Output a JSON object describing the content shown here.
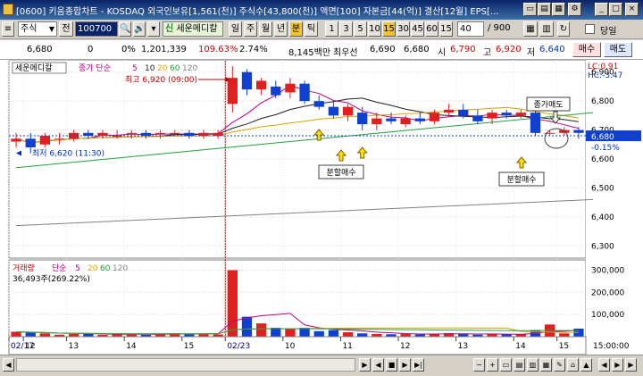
{
  "window": {
    "title": "[0600] 키움종합차트 - KOSDAQ 외국인보유[1,561(천)] 주식수[43,800(천)] 액면[100] 자본금[44(억)] 결산[12월] EPS[..."
  },
  "toolbar": {
    "market_label": "주식",
    "prev_label": "전",
    "code_value": "100700",
    "stock_name": "세운메디칼",
    "period_buttons": [
      "일",
      "주",
      "월",
      "년",
      "분",
      "틱"
    ],
    "minute_buttons": [
      "1",
      "3",
      "5",
      "10",
      "15",
      "30",
      "45",
      "60",
      "15"
    ],
    "active_period": "분",
    "count_value": "40",
    "count_total": "/ 900",
    "overlap_label": "당일"
  },
  "info": {
    "price": "6,680",
    "change": "0",
    "change_pct": "0%",
    "volume": "1,201,339",
    "vol_ratio": "109.63%",
    "turnover": "2.74%",
    "amount": "8,145백만",
    "best_ask_label": "최우선",
    "best_ask": "6,690",
    "best_bid": "6,680",
    "open_label": "시",
    "open": "6,790",
    "high_label": "고",
    "high": "6,920",
    "low_label": "저",
    "low": "6,640",
    "buy_label": "매수",
    "sell_label": "매도"
  },
  "colors": {
    "up": "#e02020",
    "down": "#1040d0",
    "ma5": "#c00080",
    "ma10": "#202020",
    "ma20": "#e0a000",
    "ma60": "#20a040",
    "ma120": "#808080"
  },
  "chart_data": {
    "type": "candlestick",
    "price_legend": {
      "name": "세운메디칼",
      "ma_label": "종가 단순",
      "periods": [
        "5",
        "10",
        "20",
        "60",
        "120"
      ]
    },
    "volume_legend": {
      "name": "거래량",
      "ma_label": "단순",
      "periods": [
        "5",
        "20",
        "60",
        "120"
      ],
      "current": "36,493주(269.22%)"
    },
    "price_axis_labels": [
      "6,900",
      "6,800",
      "6,700",
      "6,600",
      "6,500",
      "6,400",
      "6,300"
    ],
    "price_axis_values": [
      6900,
      6800,
      6700,
      6600,
      6500,
      6400,
      6300
    ],
    "price_ylim": [
      6270,
      6930
    ],
    "top_right_labels": [
      "LC:0.91",
      "HC:-3.47"
    ],
    "current_price_label": "6,680",
    "current_change_label": "-0.15%",
    "volume_axis_labels": [
      "300,000",
      "200,000",
      "100,000"
    ],
    "volume_axis_values": [
      300000,
      200000,
      100000
    ],
    "volume_ylim": [
      0,
      330000
    ],
    "x_labels": [
      "02/17",
      "12",
      "13",
      "14",
      "15",
      "02/23",
      "10",
      "11",
      "12",
      "13",
      "14",
      "15"
    ],
    "x_label_time": "15:00:00",
    "high_annotation": "최고 6,920 (09:00)",
    "low_annotation": "최저 6,620 (11:30)",
    "callouts": [
      "분할매수",
      "분할매수",
      "분할매수",
      "종가매도"
    ],
    "candles": [
      {
        "o": 6660,
        "h": 6690,
        "l": 6640,
        "c": 6670,
        "v": 22000
      },
      {
        "o": 6670,
        "h": 6690,
        "l": 6620,
        "c": 6640,
        "v": 18000
      },
      {
        "o": 6650,
        "h": 6690,
        "l": 6640,
        "c": 6680,
        "v": 15000
      },
      {
        "o": 6670,
        "h": 6690,
        "l": 6650,
        "c": 6670,
        "v": 9000
      },
      {
        "o": 6670,
        "h": 6700,
        "l": 6660,
        "c": 6690,
        "v": 12000
      },
      {
        "o": 6690,
        "h": 6700,
        "l": 6670,
        "c": 6680,
        "v": 16000
      },
      {
        "o": 6680,
        "h": 6700,
        "l": 6670,
        "c": 6690,
        "v": 8000
      },
      {
        "o": 6680,
        "h": 6700,
        "l": 6670,
        "c": 6680,
        "v": 11000
      },
      {
        "o": 6690,
        "h": 6700,
        "l": 6670,
        "c": 6690,
        "v": 10000
      },
      {
        "o": 6690,
        "h": 6700,
        "l": 6670,
        "c": 6680,
        "v": 9000
      },
      {
        "o": 6690,
        "h": 6700,
        "l": 6670,
        "c": 6690,
        "v": 14000
      },
      {
        "o": 6690,
        "h": 6700,
        "l": 6680,
        "c": 6690,
        "v": 16000
      },
      {
        "o": 6690,
        "h": 6700,
        "l": 6670,
        "c": 6680,
        "v": 12000
      },
      {
        "o": 6680,
        "h": 6700,
        "l": 6670,
        "c": 6690,
        "v": 13000
      },
      {
        "o": 6680,
        "h": 6700,
        "l": 6670,
        "c": 6690,
        "v": 10000
      },
      {
        "o": 6790,
        "h": 6920,
        "l": 6760,
        "c": 6880,
        "v": 300000
      },
      {
        "o": 6900,
        "h": 6910,
        "l": 6820,
        "c": 6840,
        "v": 90000
      },
      {
        "o": 6840,
        "h": 6880,
        "l": 6820,
        "c": 6870,
        "v": 60000
      },
      {
        "o": 6850,
        "h": 6870,
        "l": 6810,
        "c": 6820,
        "v": 40000
      },
      {
        "o": 6830,
        "h": 6880,
        "l": 6810,
        "c": 6860,
        "v": 35000
      },
      {
        "o": 6860,
        "h": 6870,
        "l": 6790,
        "c": 6800,
        "v": 40000
      },
      {
        "o": 6800,
        "h": 6820,
        "l": 6770,
        "c": 6780,
        "v": 25000
      },
      {
        "o": 6780,
        "h": 6800,
        "l": 6740,
        "c": 6750,
        "v": 30000
      },
      {
        "o": 6750,
        "h": 6790,
        "l": 6730,
        "c": 6780,
        "v": 20000
      },
      {
        "o": 6760,
        "h": 6780,
        "l": 6700,
        "c": 6720,
        "v": 15000
      },
      {
        "o": 6720,
        "h": 6760,
        "l": 6700,
        "c": 6740,
        "v": 12000
      },
      {
        "o": 6740,
        "h": 6760,
        "l": 6720,
        "c": 6730,
        "v": 11000
      },
      {
        "o": 6720,
        "h": 6750,
        "l": 6710,
        "c": 6740,
        "v": 13000
      },
      {
        "o": 6740,
        "h": 6760,
        "l": 6720,
        "c": 6730,
        "v": 10000
      },
      {
        "o": 6730,
        "h": 6770,
        "l": 6720,
        "c": 6760,
        "v": 14000
      },
      {
        "o": 6760,
        "h": 6790,
        "l": 6750,
        "c": 6770,
        "v": 16000
      },
      {
        "o": 6770,
        "h": 6790,
        "l": 6740,
        "c": 6750,
        "v": 12000
      },
      {
        "o": 6750,
        "h": 6770,
        "l": 6720,
        "c": 6730,
        "v": 9000
      },
      {
        "o": 6740,
        "h": 6770,
        "l": 6720,
        "c": 6760,
        "v": 11000
      },
      {
        "o": 6760,
        "h": 6770,
        "l": 6740,
        "c": 6750,
        "v": 10000
      },
      {
        "o": 6750,
        "h": 6770,
        "l": 6740,
        "c": 6760,
        "v": 12000
      },
      {
        "o": 6760,
        "h": 6770,
        "l": 6680,
        "c": 6690,
        "v": 30000
      },
      {
        "o": 6690,
        "h": 6700,
        "l": 6680,
        "c": 6690,
        "v": 55000
      },
      {
        "o": 6690,
        "h": 6710,
        "l": 6680,
        "c": 6700,
        "v": 15000
      },
      {
        "o": 6700,
        "h": 6710,
        "l": 6670,
        "c": 6690,
        "v": 36493
      }
    ],
    "ma60_points": [
      [
        0,
        6570
      ],
      [
        40,
        6760
      ]
    ],
    "ma120_points": [
      [
        0,
        6370
      ],
      [
        40,
        6460
      ]
    ]
  }
}
